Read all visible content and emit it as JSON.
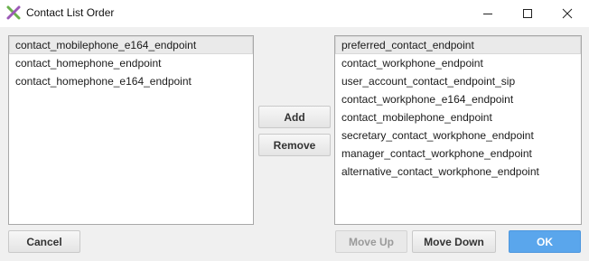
{
  "window": {
    "title": "Contact List Order",
    "icon": "x-app-icon",
    "controls": [
      "minimize-icon",
      "maximize-icon",
      "close-icon"
    ]
  },
  "available_list": {
    "items": [
      "contact_mobilephone_e164_endpoint",
      "contact_homephone_endpoint",
      "contact_homephone_e164_endpoint"
    ],
    "selected_index": 0
  },
  "middle_buttons": {
    "add_label": "Add",
    "remove_label": "Remove"
  },
  "ordered_list": {
    "items": [
      "preferred_contact_endpoint",
      "contact_workphone_endpoint",
      "user_account_contact_endpoint_sip",
      "contact_workphone_e164_endpoint",
      "contact_mobilephone_endpoint",
      "secretary_contact_workphone_endpoint",
      "manager_contact_workphone_endpoint",
      "alternative_contact_workphone_endpoint"
    ],
    "selected_index": 0
  },
  "footer": {
    "cancel_label": "Cancel",
    "move_up_label": "Move Up",
    "move_down_label": "Move Down",
    "ok_label": "OK"
  },
  "colors": {
    "accent": "#5aa6ec",
    "window_bg": "#f0f0f0",
    "list_bg": "#ffffff",
    "selection_bg": "#eaeaea"
  }
}
